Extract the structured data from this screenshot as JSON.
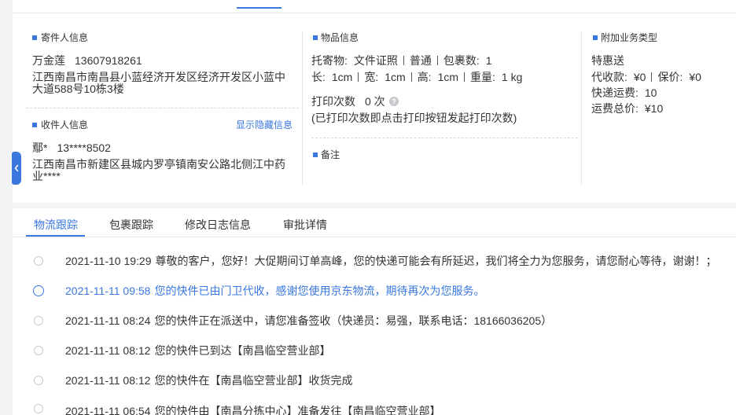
{
  "colors": {
    "accent": "#3a78e0",
    "text": "#333333",
    "page_bg": "#f2f3f5"
  },
  "collapse_handle": {
    "icon": "chevron-left-icon"
  },
  "sender": {
    "title": "寄件人信息",
    "name": "万金莲",
    "phone": "13607918261",
    "address": "江西南昌市南昌县小蓝经济开发区经济开发区小蓝中大道588号10栋3楼"
  },
  "receiver": {
    "title": "收件人信息",
    "toggle_label": "显示隐藏信息",
    "name": "鄢*",
    "phone": "13****8502",
    "address": "江西南昌市新建区县城内罗亭镇南安公路北侧江中药业****"
  },
  "goods": {
    "title": "物品信息",
    "cargo_label": "托寄物:",
    "cargo": "文件证照",
    "service": "普通",
    "packages_label": "包裹数:",
    "packages": "1",
    "dimensions": [
      {
        "label": "长:",
        "value": "1cm"
      },
      {
        "label": "宽:",
        "value": "1cm"
      },
      {
        "label": "高:",
        "value": "1cm"
      }
    ],
    "weight": {
      "label": "重量:",
      "value": "1 kg"
    },
    "print_label": "打印次数",
    "print_count": "0 次",
    "help_icon": "question-circle-icon",
    "print_note": "(已打印次数即点击打印按钮发起打印次数)"
  },
  "remarks": {
    "title": "备注"
  },
  "extra_services": {
    "title": "附加业务类型",
    "service_type": "特惠送",
    "cod_label": "代收款:",
    "cod": "¥0",
    "insured_label": "保价:",
    "insured": "¥0",
    "freight_label": "快递运费:",
    "freight": "10",
    "total_label": "运费总价:",
    "total": "¥10"
  },
  "tabs": [
    {
      "label": "物流跟踪",
      "active": true
    },
    {
      "label": "包裹跟踪",
      "active": false
    },
    {
      "label": "修改日志信息",
      "active": false
    },
    {
      "label": "审批详情",
      "active": false
    }
  ],
  "timeline": [
    {
      "time": "2021-11-10 19:29",
      "text": "尊敬的客户，您好！大促期间订单高峰，您的快递可能会有所延迟，我们将全力为您服务，请您耐心等待，谢谢！；",
      "current": false
    },
    {
      "time": "2021-11-11 09:58",
      "text": "您的快件已由门卫代收，感谢您使用京东物流，期待再次为您服务。",
      "current": true
    },
    {
      "time": "2021-11-11 08:24",
      "text": "您的快件正在派送中，请您准备签收（快递员：易强，联系电话：18166036205）",
      "current": false
    },
    {
      "time": "2021-11-11 08:12",
      "text": "您的快件已到达【南昌临空营业部】",
      "current": false
    },
    {
      "time": "2021-11-11 08:12",
      "text": "您的快件在【南昌临空营业部】收货完成",
      "current": false
    },
    {
      "time": "2021-11-11 06:54",
      "text": "您的快件由【南昌分拣中心】准备发往【南昌临空营业部】",
      "current": false
    }
  ]
}
